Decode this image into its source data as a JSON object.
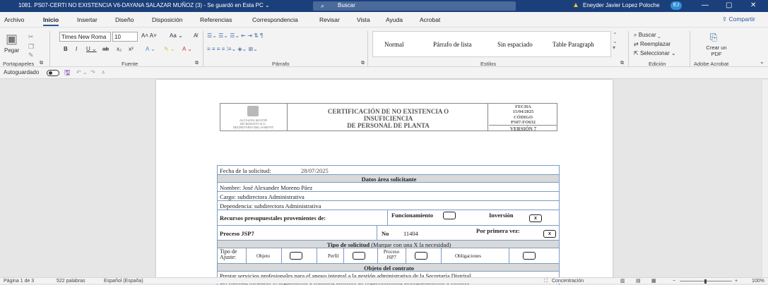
{
  "titlebar": {
    "document_title": "1081. PS07-CERTI NO EXISTENCIA V6-DAYANA SALAZAR MUÑOZ (3)  -  Se guardó en Esta PC  ⌄",
    "search_placeholder": "Buscar",
    "user_name": "Eneyder Javier Lopez Poloche",
    "user_initials": "EJ",
    "minimize": "—",
    "maximize": "▢",
    "close": "✕"
  },
  "menubar": {
    "tabs": [
      "Archivo",
      "Inicio",
      "Insertar",
      "Diseño",
      "Disposición",
      "Referencias",
      "Correspondencia",
      "Revisar",
      "Vista",
      "Ayuda",
      "Acrobat"
    ],
    "share_label": "Compartir"
  },
  "ribbon": {
    "paste_label": "Pegar",
    "font_name": "Times New Roma",
    "font_size": "10",
    "groups": {
      "clipboard": "Portapapeles",
      "font": "Fuente",
      "paragraph": "Párrafo",
      "styles": "Estilos",
      "editing": "Edición",
      "adobe": "Adobe Acrobat"
    },
    "styles": [
      "Normal",
      "Párrafo de lista",
      "Sin espaciado",
      "Table Paragraph"
    ],
    "editing": {
      "find": "Buscar",
      "replace": "Reemplazar",
      "select": "Seleccionar"
    },
    "create_pdf": "Crear un PDF"
  },
  "quickbar": {
    "autosave_label": "Autoguardado"
  },
  "document": {
    "header": {
      "logo_text_1": "ALCALDÍA MAYOR",
      "logo_text_2": "DE BOGOTÁ D.C.",
      "logo_text_3": "SECRETARÍA DEL HÁBITAT",
      "title_line_1": "CERTIFICACIÓN DE NO EXISTENCIA O",
      "title_line_2": "INSUFICIENCIA",
      "title_line_3": "DE PERSONAL DE PLANTA",
      "fecha_label": "FECHA",
      "fecha_value": "15/04/2025",
      "codigo_label": "CÓDIGO",
      "codigo_value": "PS07-FO632",
      "version": "VERSIÓN 7"
    },
    "form": {
      "fecha_solicitud_label": "Fecha de la solicitud:",
      "fecha_solicitud_value": "28/07/2025",
      "datos_area": "Datos área solicitante",
      "nombre": "Nombre: José Alexander Moreno Páez",
      "cargo": "Cargo: subdirectora Administrativa",
      "dependencia": "Dependencia: subdirectora Administrativa",
      "recursos_label": "Recursos presupuestales provenientes de:",
      "funcionamiento": "Funcionamiento",
      "inversion": "Inversión",
      "inversion_mark": "x",
      "proceso_jsp7": "Proceso JSP7",
      "no_label": "No",
      "no_value": "11404",
      "primera_vez": "Por primera vez:",
      "primera_vez_mark": "x",
      "tipo_solicitud_bold": "Tipo de solicitud",
      "tipo_solicitud_note": "(Marque con una X la necesidad)",
      "tipo_ajuste": "Tipo de Ajuste:",
      "objeto": "Objeto",
      "perfil": "Perfil",
      "proceso_jsp7_small": "Proceso JSP7",
      "obligaciones": "Obligaciones",
      "objeto_contrato": "Objeto del contrato",
      "objeto_text_1": "Prestar servicios profesionales para el apoyo integral a la gestión administrativa de la Secretaría Distrital",
      "objeto_text_2": "del Hábitat, mediante el seguimiento a trámites, atención de requerimientos, acompañamiento a comités"
    }
  },
  "statusbar": {
    "page": "Página 1 de 3",
    "words": "522 palabras",
    "language": "Español (España)",
    "focus": "Concentración",
    "zoom": "100%"
  }
}
